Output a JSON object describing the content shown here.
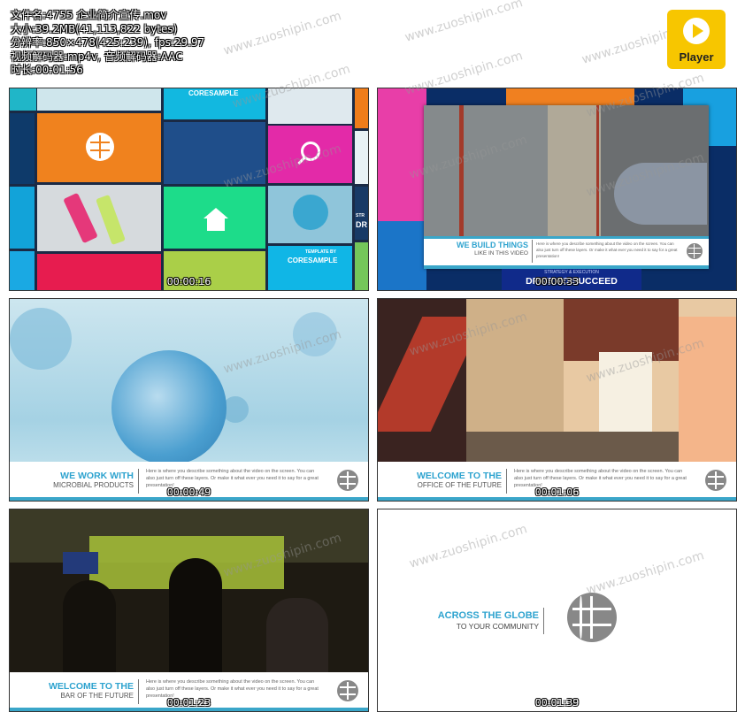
{
  "file_info": {
    "filename": "文件名:4755 企业简介宣传.mov",
    "size": "大小:39.2MB(41,113,822 bytes)",
    "resolution": "分辨率:850×478(425:239), fps:29.97",
    "codec": "视频解码器:mp4v, 音频解码器:AAC",
    "duration": "时长:00:01:56"
  },
  "player_button": {
    "label": "Player",
    "icon": "play-icon",
    "color": "#f7c600"
  },
  "watermark": "www.zuoshipin.com",
  "thumbnails": [
    {
      "timestamp": "00:00:16",
      "tiles": {
        "top_label": "CORESAMPLE",
        "bottom_small": "TEMPLATE BY",
        "bottom_label": "CORESAMPLE",
        "side_small": "STR",
        "side_label": "DR"
      }
    },
    {
      "timestamp": "00:00:33",
      "lower_title": "WE BUILD THINGS",
      "lower_sub": "LIKE IN THIS VIDEO",
      "lower_body": "Here is where you describe something about the video on the screen. You can also just turn off these layers. Or make it what ever you need it to say for a great presentation!",
      "banner_small": "STRATEGY & EXECUTION",
      "banner_label": "DRIVE TO SUCCEED"
    },
    {
      "timestamp": "00:00:49",
      "lower_title": "WE WORK WITH",
      "lower_sub": "MICROBIAL PRODUCTS",
      "lower_body": "Here is where you describe something about the video on the screen. You can also just turn off these layers. Or make it what ever you need it to say for a great presentation!"
    },
    {
      "timestamp": "00:01:06",
      "lower_title": "WELCOME TO THE",
      "lower_sub": "OFFICE OF THE FUTURE",
      "lower_body": "Here is where you describe something about the video on the screen. You can also just turn off these layers. Or make it what ever you need it to say for a great presentation!"
    },
    {
      "timestamp": "00:01:23",
      "lower_title": "WELCOME TO THE",
      "lower_sub": "BAR OF THE FUTURE",
      "lower_body": "Here is where you describe something about the video on the screen. You can also just turn off these layers. Or make it what ever you need it to say for a great presentation!"
    },
    {
      "timestamp": "00:01:39",
      "center_title": "ACROSS THE GLOBE",
      "center_sub": "TO YOUR COMMUNITY"
    }
  ],
  "colors": {
    "accent": "#2ea3cf",
    "bar": "#3aa6c9",
    "player": "#f7c600"
  },
  "icons": [
    "globe-icon",
    "house-icon",
    "magnifier-icon",
    "play-icon"
  ]
}
